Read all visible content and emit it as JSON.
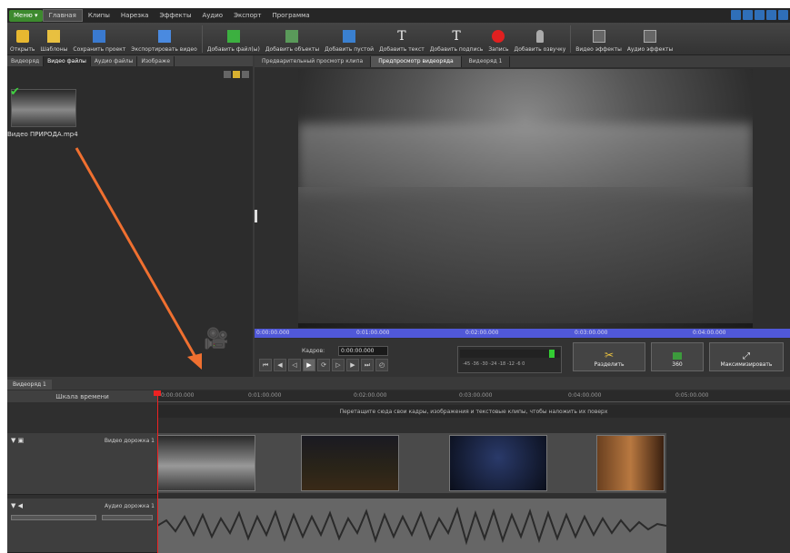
{
  "menubar": {
    "menu_label": "Меню ▾",
    "items": [
      "Главная",
      "Клипы",
      "Нарезка",
      "Эффекты",
      "Аудио",
      "Экспорт",
      "Программа"
    ]
  },
  "toolbar": {
    "items": [
      "Открыть",
      "Шаблоны",
      "Сохранить проект",
      "Экспортировать видео",
      "Добавить файл(ы)",
      "Добавить объекты",
      "Добавить пустой",
      "Добавить текст",
      "Добавить подпись",
      "Запись",
      "Добавить озвучку",
      "Видео эффекты",
      "Аудио эффекты"
    ]
  },
  "left_panel": {
    "tabs": [
      "Видеоряд",
      "Видео файлы",
      "Аудио файлы",
      "Изображе"
    ],
    "file_name": "Видео ПРИРОДА.mp4"
  },
  "right_panel": {
    "tabs": [
      "Предварительный просмотр клипа",
      "Предпросмотр видеоряда",
      "Видеоряд 1"
    ],
    "ruler_labels": [
      "0:00:00.000",
      "0:01:00.000",
      "0:02:00.000",
      "0:03:00.000",
      "0:04:00.000"
    ],
    "crop_label": "Кадров:",
    "timecode": "0:00:00.000",
    "vu_scale": "-45 -36 -30 -24 -18 -12 -6 0",
    "split_label": "Разделить",
    "btn_360": "360",
    "optimize_label": "Максимизировать"
  },
  "timeline": {
    "tab_label": "Видеоряд 1",
    "scale_label": "Шкала времени",
    "ticks": [
      "0:00:00.000",
      "0:01:00.000",
      "0:02:00.000",
      "0:03:00.000",
      "0:04:00.000",
      "0:05:00.000"
    ],
    "hint": "Перетащите сюда свои кадры, изображения и текстовые клипы, чтобы наложить их поверх",
    "video_track": "Видео дорожка 1",
    "audio_track": "Аудио дорожка 1"
  },
  "colors": {
    "accent_green": "#3d8a2e",
    "ruler_blue": "#5058d8",
    "playhead": "#e22222",
    "annotation_arrow": "#f07030"
  }
}
